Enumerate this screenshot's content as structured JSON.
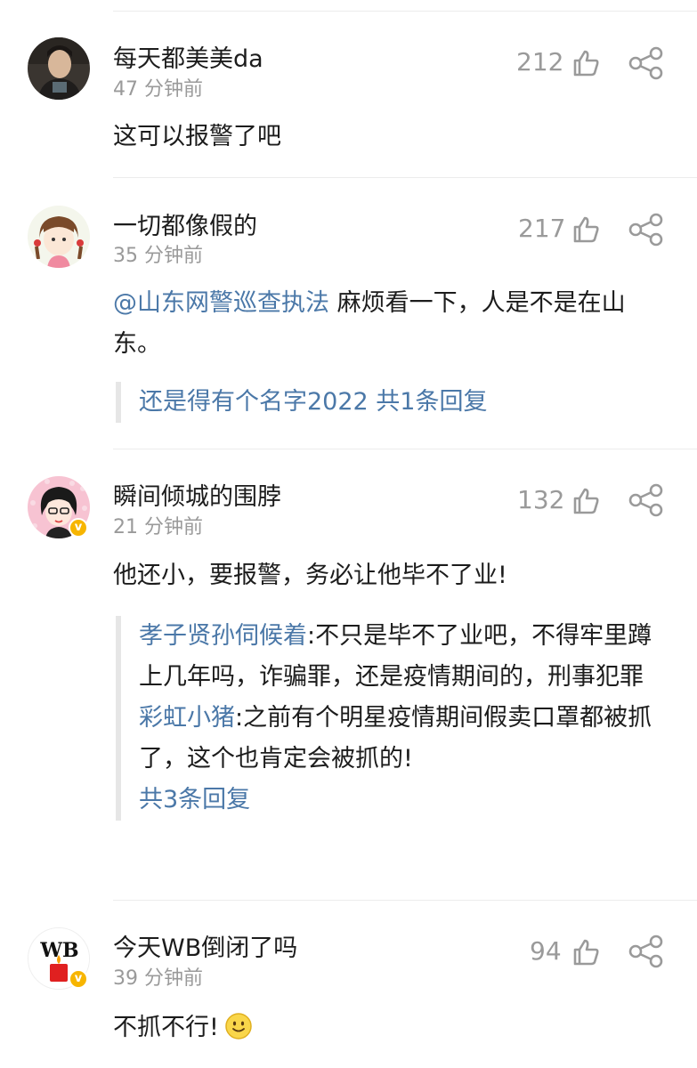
{
  "comments": [
    {
      "username": "每天都美美da",
      "time": "47 分钟前",
      "likes": "212",
      "text": "这可以报警了吧",
      "avatar": "man-portrait-avatar",
      "verified": false
    },
    {
      "username": "一切都像假的",
      "time": "35 分钟前",
      "likes": "217",
      "mention": "@山东网警巡查执法",
      "text": " 麻烦看一下，人是不是在山东。",
      "reply_summary": "还是得有个名字2022 共1条回复",
      "avatar": "cartoon-girl-avatar",
      "verified": false
    },
    {
      "username": "瞬间倾城的围脖",
      "time": "21 分钟前",
      "likes": "132",
      "text": "他还小，要报警，务必让他毕不了业!",
      "replies": [
        {
          "name": "孝子贤孙伺候着",
          "text": ":不只是毕不了业吧，不得牢里蹲上几年吗，诈骗罪，还是疫情期间的，刑事犯罪"
        },
        {
          "name": "彩虹小猪",
          "text": ":之前有个明星疫情期间假卖口罩都被抓了，这个也肯定会被抓的!"
        }
      ],
      "reply_more": "共3条回复",
      "avatar": "glasses-lady-avatar",
      "verified": true,
      "verified_mark": "v"
    },
    {
      "username": "今天WB倒闭了吗",
      "time": "39 分钟前",
      "likes": "94",
      "text": "不抓不行!",
      "emoji": "smile-emoji",
      "avatar": "wb-logo-avatar",
      "avatar_text": "WB",
      "verified": true,
      "verified_mark": "v"
    }
  ],
  "icons": {
    "like": "thumbs-up-icon",
    "share": "share-icon"
  },
  "colors": {
    "link": "#4b78a8",
    "muted": "#9a9a9a",
    "text": "#1c1c1c",
    "badge": "#f7b500"
  }
}
